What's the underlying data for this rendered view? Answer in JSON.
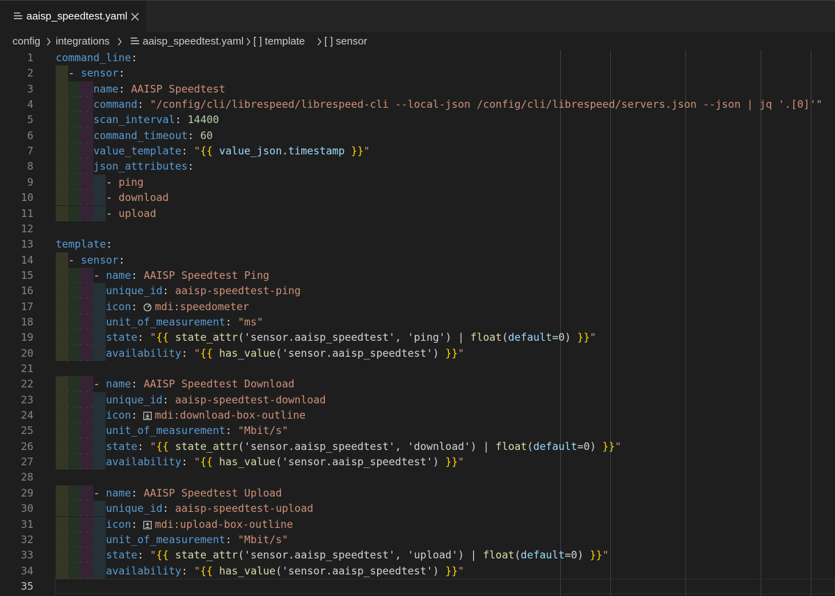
{
  "tab": {
    "filename": "aaisp_speedtest.yaml",
    "file_icon": "lines-file-icon",
    "close_icon": "close-icon"
  },
  "breadcrumb": {
    "items": [
      "config",
      "integrations",
      "aaisp_speedtest.yaml",
      "[ ] template",
      "[ ] sensor"
    ]
  },
  "editor": {
    "current_line": 35,
    "lines": [
      {
        "n": "1",
        "code": "command_line:"
      },
      {
        "n": "2",
        "code": "  - sensor:"
      },
      {
        "n": "3",
        "code": "      name: AAISP Speedtest"
      },
      {
        "n": "4",
        "code": "      command: \"/config/cli/librespeed/librespeed-cli --local-json /config/cli/librespeed/servers.json --json | jq '.[0]'\""
      },
      {
        "n": "5",
        "code": "      scan_interval: 14400"
      },
      {
        "n": "6",
        "code": "      command_timeout: 60"
      },
      {
        "n": "7",
        "code": "      value_template: \"{{ value_json.timestamp }}\""
      },
      {
        "n": "8",
        "code": "      json_attributes:"
      },
      {
        "n": "9",
        "code": "        - ping"
      },
      {
        "n": "10",
        "code": "        - download"
      },
      {
        "n": "11",
        "code": "        - upload"
      },
      {
        "n": "12",
        "code": ""
      },
      {
        "n": "13",
        "code": "template:"
      },
      {
        "n": "14",
        "code": "  - sensor:"
      },
      {
        "n": "15",
        "code": "      - name: AAISP Speedtest Ping"
      },
      {
        "n": "16",
        "code": "        unique_id: aaisp-speedtest-ping"
      },
      {
        "n": "17",
        "code": "        icon: mdi:speedometer"
      },
      {
        "n": "18",
        "code": "        unit_of_measurement: \"ms\""
      },
      {
        "n": "19",
        "code": "        state: \"{{ state_attr('sensor.aaisp_speedtest', 'ping') | float(default=0) }}\""
      },
      {
        "n": "20",
        "code": "        availability: \"{{ has_value('sensor.aaisp_speedtest') }}\""
      },
      {
        "n": "21",
        "code": ""
      },
      {
        "n": "22",
        "code": "      - name: AAISP Speedtest Download"
      },
      {
        "n": "23",
        "code": "        unique_id: aaisp-speedtest-download"
      },
      {
        "n": "24",
        "code": "        icon: mdi:download-box-outline"
      },
      {
        "n": "25",
        "code": "        unit_of_measurement: \"Mbit/s\""
      },
      {
        "n": "26",
        "code": "        state: \"{{ state_attr('sensor.aaisp_speedtest', 'download') | float(default=0) }}\""
      },
      {
        "n": "27",
        "code": "        availability: \"{{ has_value('sensor.aaisp_speedtest') }}\""
      },
      {
        "n": "28",
        "code": ""
      },
      {
        "n": "29",
        "code": "      - name: AAISP Speedtest Upload"
      },
      {
        "n": "30",
        "code": "        unique_id: aaisp-speedtest-upload"
      },
      {
        "n": "31",
        "code": "        icon: mdi:upload-box-outline"
      },
      {
        "n": "32",
        "code": "        unit_of_measurement: \"Mbit/s\""
      },
      {
        "n": "33",
        "code": "        state: \"{{ state_attr('sensor.aaisp_speedtest', 'upload') | float(default=0) }}\""
      },
      {
        "n": "34",
        "code": "        availability: \"{{ has_value('sensor.aaisp_speedtest') }}\""
      },
      {
        "n": "35",
        "code": ""
      }
    ]
  },
  "colors": {
    "background": "#1e1e1e",
    "key": "#569cd6",
    "string": "#ce9178",
    "number": "#b5cea8",
    "line_number": "#858585",
    "template_brace": "#ffd700",
    "function": "#dcdcaa",
    "variable": "#9cdcfe"
  },
  "gutter_icons": {
    "17": "speedometer-icon",
    "24": "download-box-outline-icon",
    "31": "upload-box-outline-icon"
  }
}
